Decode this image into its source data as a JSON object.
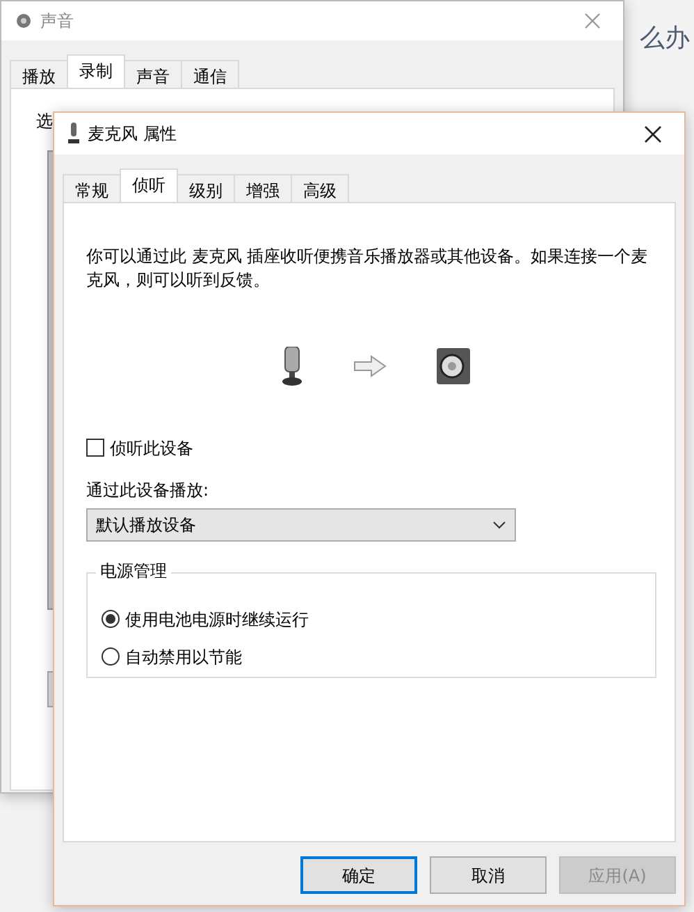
{
  "background_page": {
    "heading_fragment": "么办"
  },
  "back_window": {
    "title": "声音",
    "tabs": [
      {
        "label": "播放",
        "selected": false
      },
      {
        "label": "录制",
        "selected": true
      },
      {
        "label": "声音",
        "selected": false
      },
      {
        "label": "通信",
        "selected": false
      }
    ],
    "content_fragment": "选"
  },
  "front_window": {
    "title": "麦克风 属性",
    "tabs": [
      {
        "label": "常规",
        "selected": false
      },
      {
        "label": "侦听",
        "selected": true
      },
      {
        "label": "级别",
        "selected": false
      },
      {
        "label": "增强",
        "selected": false
      },
      {
        "label": "高级",
        "selected": false
      }
    ],
    "description": "你可以通过此 麦克风 插座收听便携音乐播放器或其他设备。如果连接一个麦克风，则可以听到反馈。",
    "listen_checkbox": {
      "label": "侦听此设备",
      "checked": false
    },
    "playback_label": "通过此设备播放:",
    "playback_select": {
      "value": "默认播放设备"
    },
    "power_group": {
      "title": "电源管理",
      "options": [
        {
          "label": "使用电池电源时继续运行",
          "selected": true
        },
        {
          "label": "自动禁用以节能",
          "selected": false
        }
      ]
    },
    "buttons": [
      {
        "label": "确定",
        "kind": "default",
        "disabled": false
      },
      {
        "label": "取消",
        "kind": "normal",
        "disabled": false
      },
      {
        "label": "应用(A)",
        "kind": "normal",
        "disabled": true
      }
    ]
  }
}
